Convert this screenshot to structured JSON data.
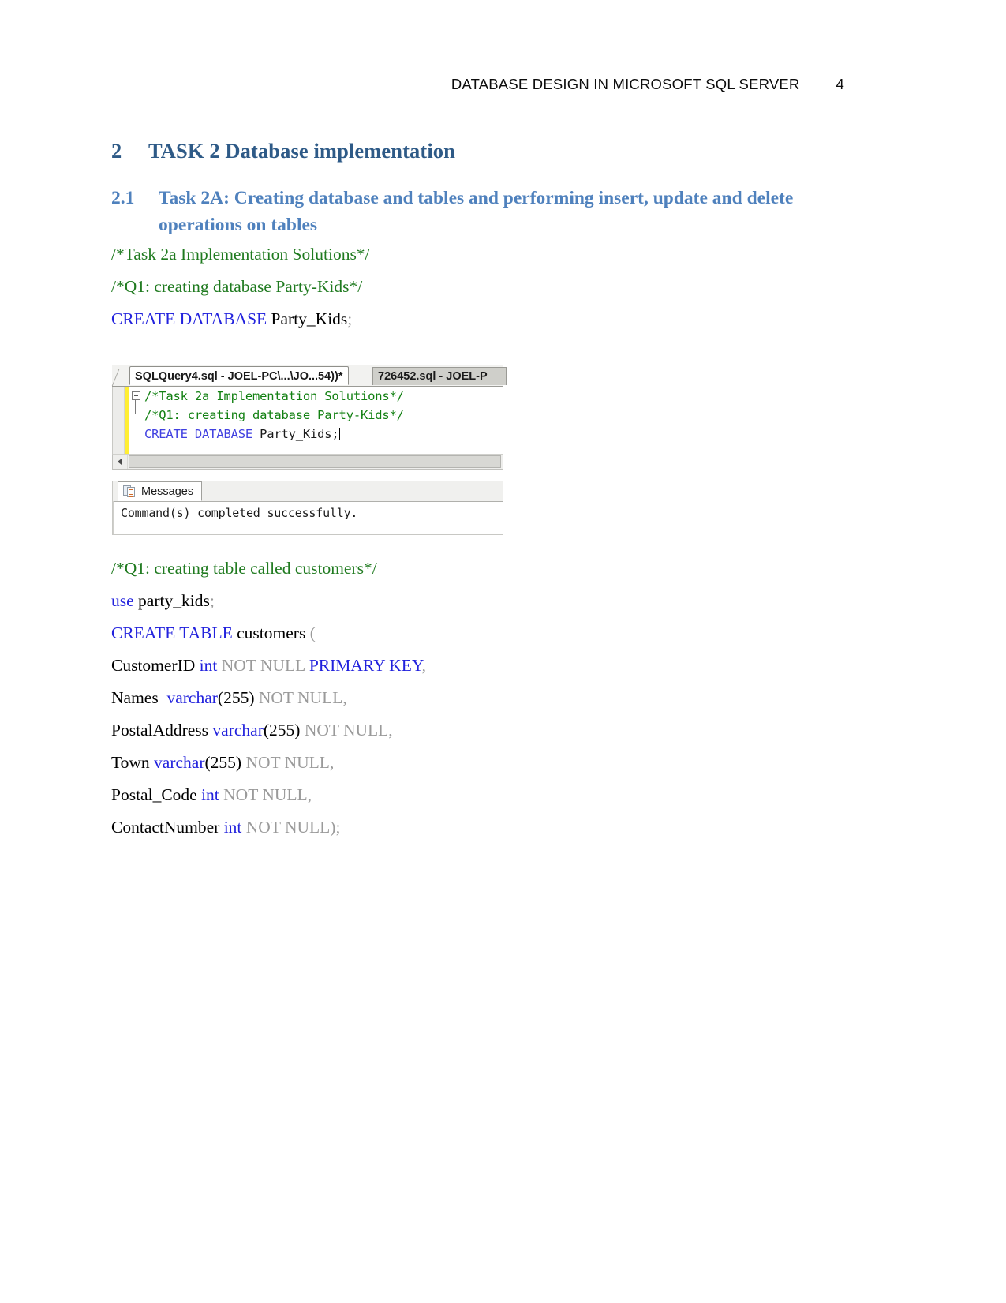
{
  "header": {
    "title": "DATABASE DESIGN IN MICROSOFT SQL SERVER",
    "page_number": "4"
  },
  "headings": {
    "h1_number": "2",
    "h1_text": "TASK 2 Database implementation",
    "h2_number": "2.1",
    "h2_text": "Task 2A: Creating database and tables and performing insert, update and delete operations on tables"
  },
  "sql_top": {
    "line1_comment": "/*Task 2a Implementation Solutions*/",
    "line2_comment": "/*Q1: creating database Party-Kids*/",
    "line3_keyword": "CREATE DATABASE",
    "line3_name": " Party_Kids",
    "line3_semicolon": ";"
  },
  "ssms": {
    "tab_active": "SQLQuery4.sql - JOEL-PC\\...\\JO...54))*",
    "tab_inactive": "726452.sql - JOEL-P",
    "code_line1": "/*Task 2a Implementation Solutions*/",
    "code_line2": "/*Q1: creating database Party-Kids*/",
    "code_line3_keyword": "CREATE DATABASE",
    "code_line3_name": " Party_Kids;",
    "results_tab_label": "Messages",
    "results_message": "Command(s) completed successfully."
  },
  "sql_bottom": {
    "comment": "/*Q1: creating table called customers*/",
    "use_keyword": "use",
    "use_db": " party_kids",
    "use_semicolon": ";",
    "create_keyword": "CREATE TABLE",
    "create_table": " customers ",
    "create_paren": "(",
    "columns": [
      {
        "name": "CustomerID ",
        "type": "int",
        "type_suffix": "",
        "constraint": " NOT NULL ",
        "extra": "PRIMARY KEY",
        "tail": ","
      },
      {
        "name": "Names  ",
        "type": "varchar",
        "type_suffix": "(255)",
        "constraint": " NOT NULL,",
        "extra": "",
        "tail": ""
      },
      {
        "name": "PostalAddress ",
        "type": "varchar",
        "type_suffix": "(255)",
        "constraint": " NOT NULL,",
        "extra": "",
        "tail": ""
      },
      {
        "name": "Town ",
        "type": "varchar",
        "type_suffix": "(255)",
        "constraint": " NOT NULL,",
        "extra": "",
        "tail": ""
      },
      {
        "name": "Postal_Code ",
        "type": "int",
        "type_suffix": "",
        "constraint": " NOT NULL,",
        "extra": "",
        "tail": ""
      },
      {
        "name": "ContactNumber ",
        "type": "int",
        "type_suffix": "",
        "constraint": " NOT NULL)",
        "extra": "",
        "tail": ";"
      }
    ]
  },
  "colors": {
    "heading1": "#2e5a87",
    "heading2": "#4f81bd",
    "comment_green": "#1f7a1f",
    "keyword_blue": "#2222dd",
    "gray_text": "#9a9a9a"
  }
}
